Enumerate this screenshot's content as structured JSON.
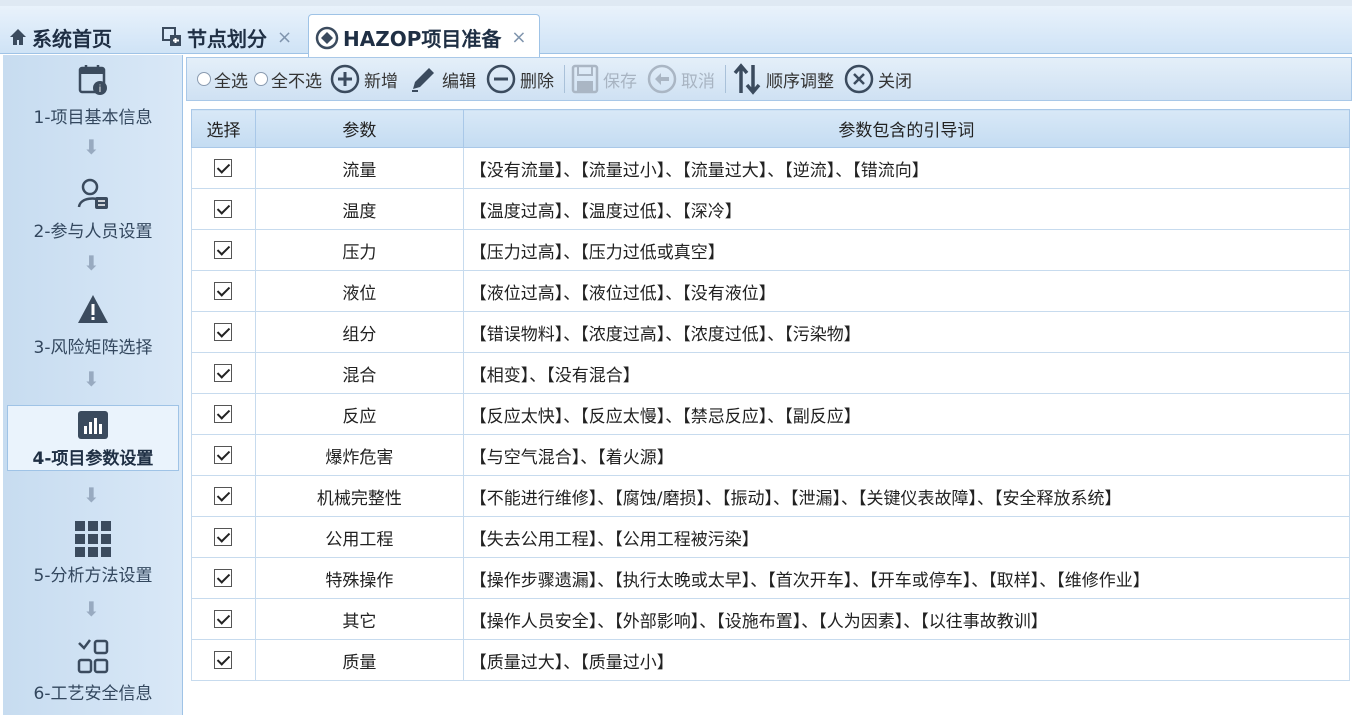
{
  "tabs": [
    {
      "label": "系统首页",
      "icon": "home-icon",
      "closable": false
    },
    {
      "label": "节点划分",
      "icon": "node-split-icon",
      "closable": true
    },
    {
      "label": "HAZOP项目准备",
      "icon": "hazop-icon",
      "closable": true,
      "active": true
    }
  ],
  "tab_close_glyph": "×",
  "steps": [
    {
      "label": "1-项目基本信息",
      "icon": "calendar-info-icon"
    },
    {
      "label": "2-参与人员设置",
      "icon": "user-list-icon"
    },
    {
      "label": "3-风险矩阵选择",
      "icon": "warning-icon"
    },
    {
      "label": "4-项目参数设置",
      "icon": "bar-chart-icon",
      "active": true
    },
    {
      "label": "5-分析方法设置",
      "icon": "grid-icon"
    },
    {
      "label": "6-工艺安全信息",
      "icon": "process-blocks-icon"
    }
  ],
  "step_arrow": "⬇",
  "toolbar": {
    "select_all": "全选",
    "select_none": "全不选",
    "add": "新增",
    "edit": "编辑",
    "delete": "删除",
    "save": "保存",
    "cancel": "取消",
    "reorder": "顺序调整",
    "close": "关闭"
  },
  "columns": [
    "选择",
    "参数",
    "参数包含的引导词"
  ],
  "rows": [
    {
      "checked": true,
      "param": "流量",
      "guide_words": "【没有流量】、【流量过小】、【流量过大】、【逆流】、【错流向】"
    },
    {
      "checked": true,
      "param": "温度",
      "guide_words": "【温度过高】、【温度过低】、【深冷】"
    },
    {
      "checked": true,
      "param": "压力",
      "guide_words": "【压力过高】、【压力过低或真空】"
    },
    {
      "checked": true,
      "param": "液位",
      "guide_words": "【液位过高】、【液位过低】、【没有液位】"
    },
    {
      "checked": true,
      "param": "组分",
      "guide_words": "【错误物料】、【浓度过高】、【浓度过低】、【污染物】"
    },
    {
      "checked": true,
      "param": "混合",
      "guide_words": "【相变】、【没有混合】"
    },
    {
      "checked": true,
      "param": "反应",
      "guide_words": "【反应太快】、【反应太慢】、【禁忌反应】、【副反应】"
    },
    {
      "checked": true,
      "param": "爆炸危害",
      "guide_words": "【与空气混合】、【着火源】"
    },
    {
      "checked": true,
      "param": "机械完整性",
      "guide_words": "【不能进行维修】、【腐蚀/磨损】、【振动】、【泄漏】、【关键仪表故障】、【安全释放系统】"
    },
    {
      "checked": true,
      "param": "公用工程",
      "guide_words": "【失去公用工程】、【公用工程被污染】"
    },
    {
      "checked": true,
      "param": "特殊操作",
      "guide_words": "【操作步骤遗漏】、【执行太晚或太早】、【首次开车】、【开车或停车】、【取样】、【维修作业】"
    },
    {
      "checked": true,
      "param": "其它",
      "guide_words": "【操作人员安全】、【外部影响】、【设施布置】、【人为因素】、【以往事故教训】"
    },
    {
      "checked": true,
      "param": "质量",
      "guide_words": "【质量过大】、【质量过小】"
    }
  ]
}
